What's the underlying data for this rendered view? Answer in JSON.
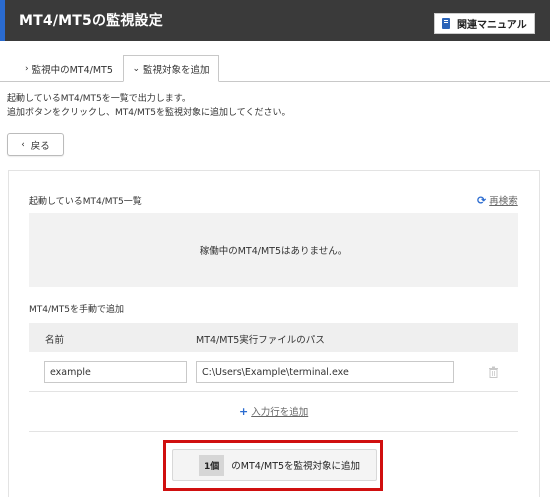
{
  "header": {
    "title": "MT4/MT5の監視設定",
    "manual_button": "関連マニュアル",
    "accent_color": "#2a6bd0"
  },
  "tabs": [
    {
      "label": "監視中のMT4/MT5",
      "icon": "chevron-right-icon",
      "active": false
    },
    {
      "label": "監視対象を追加",
      "icon": "chevron-down-icon",
      "active": true
    }
  ],
  "description": {
    "line1": "起動しているMT4/MT5を一覧で出力します。",
    "line2": "追加ボタンをクリックし、MT4/MT5を監視対象に追加してください。"
  },
  "back_button": "戻る",
  "running_section": {
    "title": "起動しているMT4/MT5一覧",
    "rescan_label": "再検索",
    "empty_message": "稼働中のMT4/MT5はありません。"
  },
  "manual_section": {
    "title": "MT4/MT5を手動で追加",
    "columns": [
      "名前",
      "MT4/MT5実行ファイルのパス"
    ],
    "rows": [
      {
        "name": "example",
        "path": "C:\\Users\\Example\\terminal.exe"
      }
    ],
    "add_row_label": "入力行を追加"
  },
  "submit": {
    "count": "1個",
    "label": "のMT4/MT5を監視対象に追加",
    "highlight_color": "#d00f0f"
  }
}
